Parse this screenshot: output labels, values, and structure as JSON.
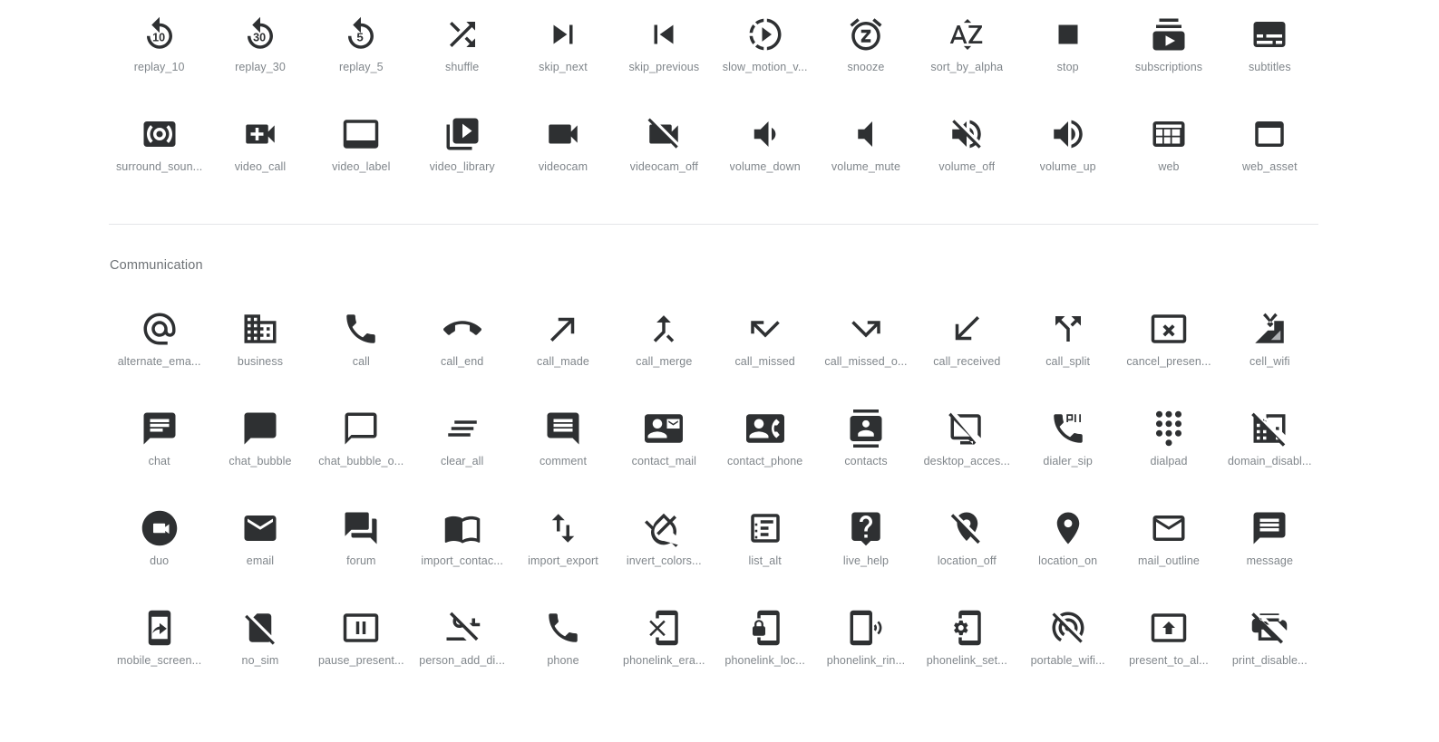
{
  "page": {
    "background_color": "#ffffff",
    "icon_color": "#2e3032",
    "label_color": "#80868b",
    "divider_color": "#e4e6e8"
  },
  "sections": [
    {
      "name": "av-continued",
      "title": "",
      "rows": [
        [
          {
            "label": "replay_10",
            "icon": "replay-10-icon"
          },
          {
            "label": "replay_30",
            "icon": "replay-30-icon"
          },
          {
            "label": "replay_5",
            "icon": "replay-5-icon"
          },
          {
            "label": "shuffle",
            "icon": "shuffle-icon"
          },
          {
            "label": "skip_next",
            "icon": "skip-next-icon"
          },
          {
            "label": "skip_previous",
            "icon": "skip-previous-icon"
          },
          {
            "label": "slow_motion_v...",
            "icon": "slow-motion-video-icon"
          },
          {
            "label": "snooze",
            "icon": "snooze-icon"
          },
          {
            "label": "sort_by_alpha",
            "icon": "sort-by-alpha-icon"
          },
          {
            "label": "stop",
            "icon": "stop-icon"
          },
          {
            "label": "subscriptions",
            "icon": "subscriptions-icon"
          },
          {
            "label": "subtitles",
            "icon": "subtitles-icon"
          }
        ],
        [
          {
            "label": "surround_soun...",
            "icon": "surround-sound-icon"
          },
          {
            "label": "video_call",
            "icon": "video-call-icon"
          },
          {
            "label": "video_label",
            "icon": "video-label-icon"
          },
          {
            "label": "video_library",
            "icon": "video-library-icon"
          },
          {
            "label": "videocam",
            "icon": "videocam-icon"
          },
          {
            "label": "videocam_off",
            "icon": "videocam-off-icon"
          },
          {
            "label": "volume_down",
            "icon": "volume-down-icon"
          },
          {
            "label": "volume_mute",
            "icon": "volume-mute-icon"
          },
          {
            "label": "volume_off",
            "icon": "volume-off-icon"
          },
          {
            "label": "volume_up",
            "icon": "volume-up-icon"
          },
          {
            "label": "web",
            "icon": "web-icon"
          },
          {
            "label": "web_asset",
            "icon": "web-asset-icon"
          }
        ]
      ]
    },
    {
      "name": "communication",
      "title": "Communication",
      "rows": [
        [
          {
            "label": "alternate_ema...",
            "icon": "alternate-email-icon"
          },
          {
            "label": "business",
            "icon": "business-icon"
          },
          {
            "label": "call",
            "icon": "call-icon"
          },
          {
            "label": "call_end",
            "icon": "call-end-icon"
          },
          {
            "label": "call_made",
            "icon": "call-made-icon"
          },
          {
            "label": "call_merge",
            "icon": "call-merge-icon"
          },
          {
            "label": "call_missed",
            "icon": "call-missed-icon"
          },
          {
            "label": "call_missed_o...",
            "icon": "call-missed-outgoing-icon"
          },
          {
            "label": "call_received",
            "icon": "call-received-icon"
          },
          {
            "label": "call_split",
            "icon": "call-split-icon"
          },
          {
            "label": "cancel_presen...",
            "icon": "cancel-presentation-icon"
          },
          {
            "label": "cell_wifi",
            "icon": "cell-wifi-icon"
          }
        ],
        [
          {
            "label": "chat",
            "icon": "chat-icon"
          },
          {
            "label": "chat_bubble",
            "icon": "chat-bubble-icon"
          },
          {
            "label": "chat_bubble_o...",
            "icon": "chat-bubble-outline-icon"
          },
          {
            "label": "clear_all",
            "icon": "clear-all-icon"
          },
          {
            "label": "comment",
            "icon": "comment-icon"
          },
          {
            "label": "contact_mail",
            "icon": "contact-mail-icon"
          },
          {
            "label": "contact_phone",
            "icon": "contact-phone-icon"
          },
          {
            "label": "contacts",
            "icon": "contacts-icon"
          },
          {
            "label": "desktop_acces...",
            "icon": "desktop-access-disabled-icon"
          },
          {
            "label": "dialer_sip",
            "icon": "dialer-sip-icon"
          },
          {
            "label": "dialpad",
            "icon": "dialpad-icon"
          },
          {
            "label": "domain_disabl...",
            "icon": "domain-disabled-icon"
          }
        ],
        [
          {
            "label": "duo",
            "icon": "duo-icon"
          },
          {
            "label": "email",
            "icon": "email-icon"
          },
          {
            "label": "forum",
            "icon": "forum-icon"
          },
          {
            "label": "import_contac...",
            "icon": "import-contacts-icon"
          },
          {
            "label": "import_export",
            "icon": "import-export-icon"
          },
          {
            "label": "invert_colors...",
            "icon": "invert-colors-off-icon"
          },
          {
            "label": "list_alt",
            "icon": "list-alt-icon"
          },
          {
            "label": "live_help",
            "icon": "live-help-icon"
          },
          {
            "label": "location_off",
            "icon": "location-off-icon"
          },
          {
            "label": "location_on",
            "icon": "location-on-icon"
          },
          {
            "label": "mail_outline",
            "icon": "mail-outline-icon"
          },
          {
            "label": "message",
            "icon": "message-icon"
          }
        ],
        [
          {
            "label": "mobile_screen...",
            "icon": "mobile-screen-share-icon"
          },
          {
            "label": "no_sim",
            "icon": "no-sim-icon"
          },
          {
            "label": "pause_present...",
            "icon": "pause-presentation-icon"
          },
          {
            "label": "person_add_di...",
            "icon": "person-add-disabled-icon"
          },
          {
            "label": "phone",
            "icon": "phone-icon"
          },
          {
            "label": "phonelink_era...",
            "icon": "phonelink-erase-icon"
          },
          {
            "label": "phonelink_loc...",
            "icon": "phonelink-lock-icon"
          },
          {
            "label": "phonelink_rin...",
            "icon": "phonelink-ring-icon"
          },
          {
            "label": "phonelink_set...",
            "icon": "phonelink-setup-icon"
          },
          {
            "label": "portable_wifi...",
            "icon": "portable-wifi-off-icon"
          },
          {
            "label": "present_to_al...",
            "icon": "present-to-all-icon"
          },
          {
            "label": "print_disable...",
            "icon": "print-disabled-icon"
          }
        ]
      ]
    }
  ]
}
